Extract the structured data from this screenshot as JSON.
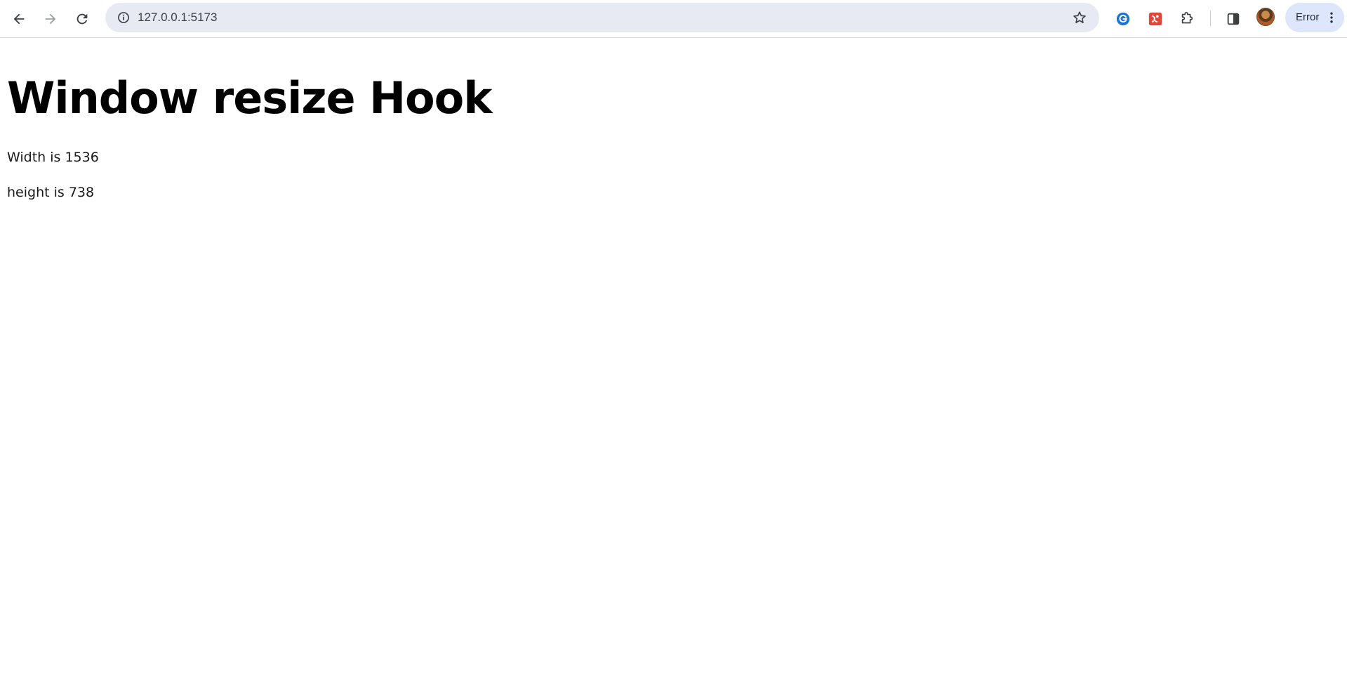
{
  "browser": {
    "url": "127.0.0.1:5173",
    "profile_status": "Error",
    "icons": {
      "back": "back-arrow-icon",
      "forward": "forward-arrow-icon",
      "reload": "reload-icon",
      "site_info": "info-icon",
      "bookmark": "star-icon",
      "ext1": "grammarly-extension-icon",
      "ext2": "red-extension-icon",
      "extensions": "puzzle-icon",
      "side_panel": "side-panel-icon",
      "menu": "kebab-menu-icon"
    },
    "colors": {
      "omnibox_bg": "#e8eaf3",
      "error_chip_bg": "#dde6fb",
      "grammarly_blue": "#1a73d8",
      "extension_red": "#e0463a"
    }
  },
  "page": {
    "title": "Window resize Hook",
    "width_text": "Width is 1536",
    "height_text": "height is 738"
  }
}
